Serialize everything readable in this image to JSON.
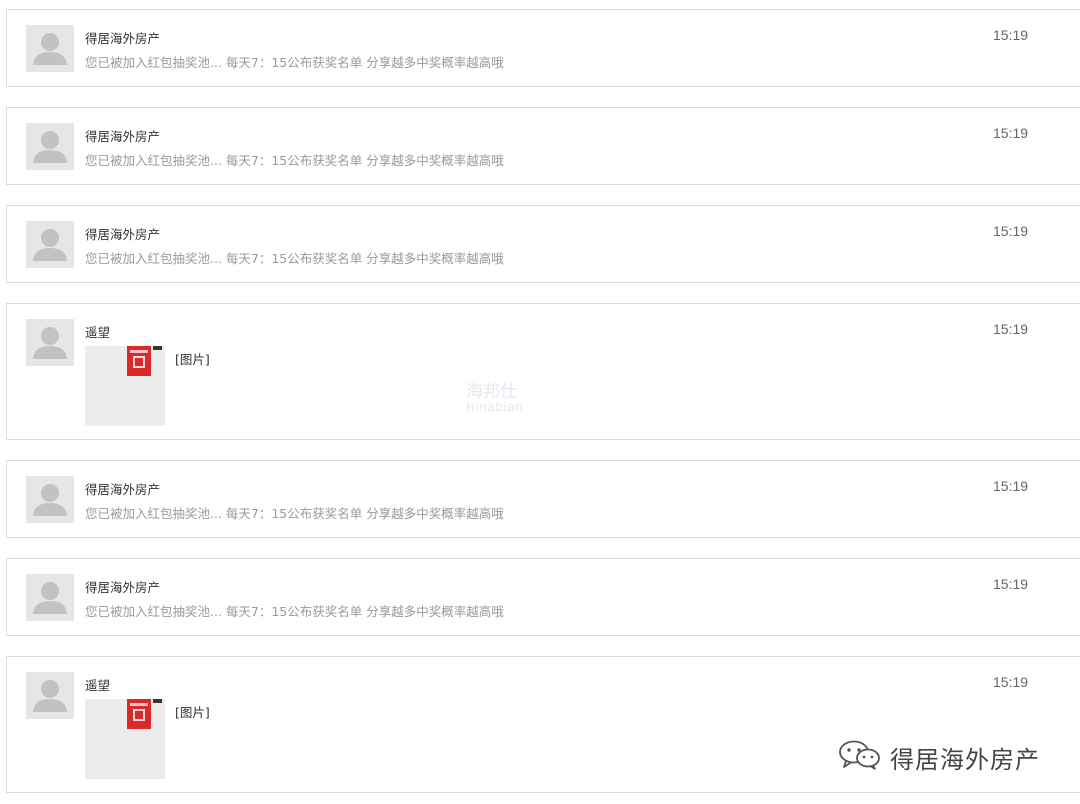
{
  "messages": [
    {
      "sender": "得居海外房产",
      "text": "您已被加入红包抽奖池... 每天7：15公布获奖名单 分享越多中奖概率越高哦",
      "time": "15:19"
    },
    {
      "sender": "得居海外房产",
      "text": "您已被加入红包抽奖池... 每天7：15公布获奖名单 分享越多中奖概率越高哦",
      "time": "15:19"
    },
    {
      "sender": "得居海外房产",
      "text": "您已被加入红包抽奖池... 每天7：15公布获奖名单 分享越多中奖概率越高哦",
      "time": "15:19"
    },
    {
      "sender": "遥望",
      "image_label": "[图片]",
      "time": "15:19"
    },
    {
      "sender": "得居海外房产",
      "text": "您已被加入红包抽奖池... 每天7：15公布获奖名单 分享越多中奖概率越高哦",
      "time": "15:19"
    },
    {
      "sender": "得居海外房产",
      "text": "您已被加入红包抽奖池... 每天7：15公布获奖名单 分享越多中奖概率越高哦",
      "time": "15:19"
    },
    {
      "sender": "遥望",
      "image_label": "[图片]",
      "time": "15:19"
    }
  ],
  "watermark": {
    "line1": "海邦仕",
    "line2": "Hinabian"
  },
  "brand": {
    "name": "得居海外房产",
    "icon": "wechat-icon"
  },
  "colors": {
    "border": "#dcdcdc",
    "avatar_bg": "#e6e6e6",
    "preview_text": "#9a9a9a"
  }
}
